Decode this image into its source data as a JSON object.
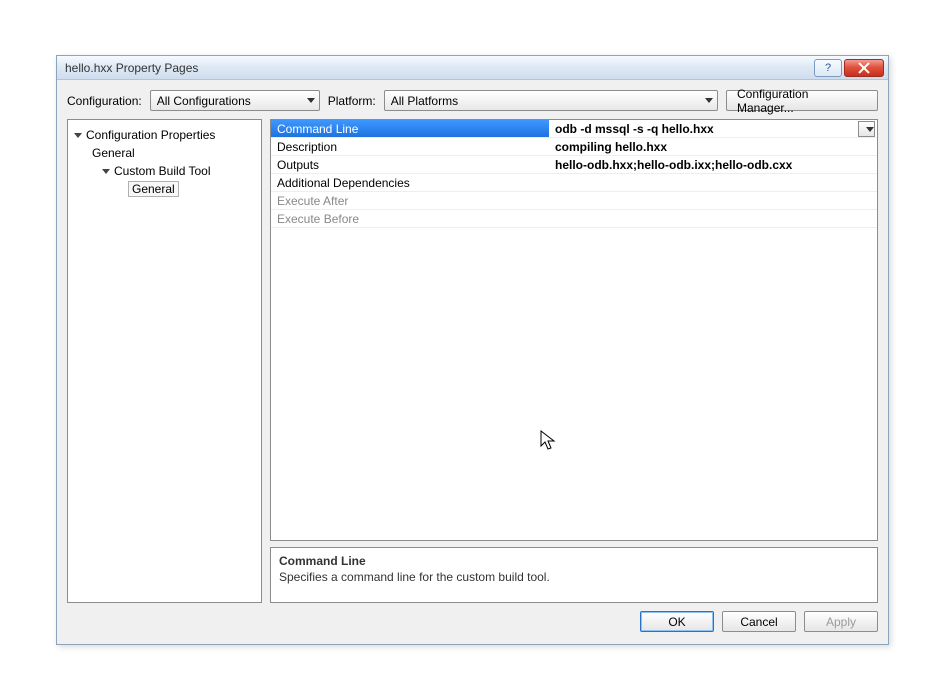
{
  "window": {
    "title": "hello.hxx Property Pages"
  },
  "toolbar": {
    "config_label": "Configuration:",
    "config_value": "All Configurations",
    "platform_label": "Platform:",
    "platform_value": "All Platforms",
    "manager_button": "Configuration Manager..."
  },
  "tree": {
    "root": "Configuration Properties",
    "general": "General",
    "custom_build_tool": "Custom Build Tool",
    "cbt_general": "General"
  },
  "grid": {
    "rows": [
      {
        "name": "Command Line",
        "value": "odb -d mssql -s -q hello.hxx",
        "selected": true,
        "bold": true
      },
      {
        "name": "Description",
        "value": "compiling hello.hxx",
        "bold": true
      },
      {
        "name": "Outputs",
        "value": "hello-odb.hxx;hello-odb.ixx;hello-odb.cxx",
        "bold": true
      },
      {
        "name": "Additional Dependencies",
        "value": ""
      },
      {
        "name": "Execute After",
        "value": "",
        "dim": true
      },
      {
        "name": "Execute Before",
        "value": "",
        "dim": true
      }
    ]
  },
  "help": {
    "title": "Command Line",
    "desc": "Specifies a command line for the custom build tool."
  },
  "footer": {
    "ok": "OK",
    "cancel": "Cancel",
    "apply": "Apply"
  }
}
